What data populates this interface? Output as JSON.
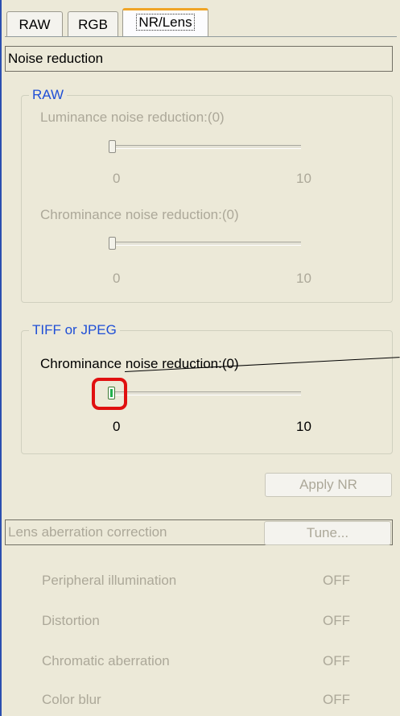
{
  "tabs": [
    {
      "label": "RAW"
    },
    {
      "label": "RGB"
    },
    {
      "label": "NR/Lens",
      "active": true
    }
  ],
  "noise_reduction": {
    "header": "Noise reduction",
    "raw_group": {
      "legend": "RAW",
      "luminance": {
        "label": "Luminance noise reduction:(0)",
        "value": 0,
        "min_label": "0",
        "max_label": "10"
      },
      "chrominance": {
        "label": "Chrominance noise reduction:(0)",
        "value": 0,
        "min_label": "0",
        "max_label": "10"
      }
    },
    "tiff_group": {
      "legend": "TIFF or JPEG",
      "chrominance": {
        "label": "Chrominance noise reduction:(0)",
        "value": 0,
        "min_label": "0",
        "max_label": "10"
      }
    },
    "apply_button": "Apply NR"
  },
  "lens": {
    "header": "Lens aberration correction",
    "tune_button": "Tune...",
    "rows": [
      {
        "label": "Peripheral illumination",
        "value": "OFF"
      },
      {
        "label": "Distortion",
        "value": "OFF"
      },
      {
        "label": "Chromatic aberration",
        "value": "OFF"
      },
      {
        "label": "Color blur",
        "value": "OFF"
      }
    ]
  },
  "colors": {
    "accent": "#1f4fd6",
    "highlight": "#e01010",
    "tab_active": "#f0a526"
  }
}
